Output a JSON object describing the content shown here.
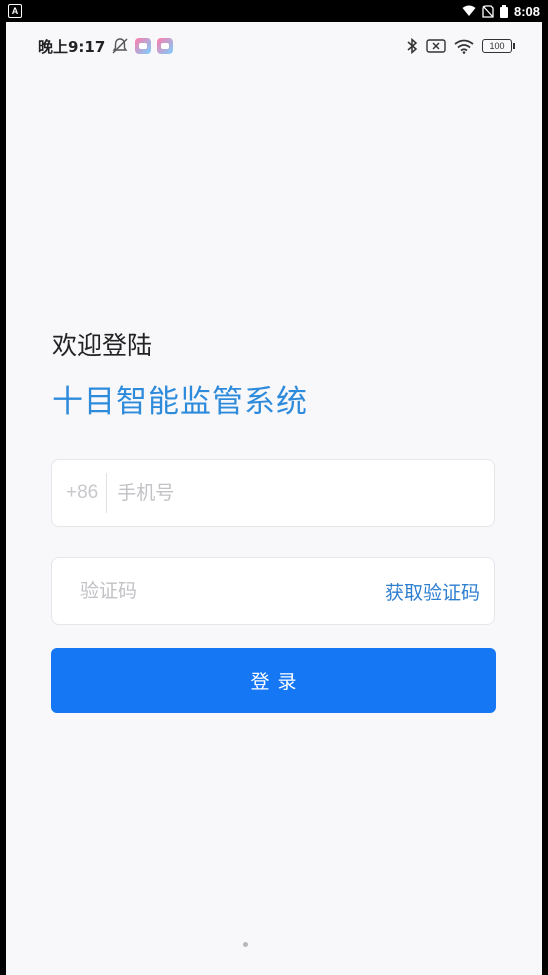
{
  "system_bar": {
    "badge": "A",
    "time": "8:08",
    "icons": [
      "wifi-icon",
      "no-sim-icon",
      "battery-icon"
    ]
  },
  "status_bar": {
    "time": "晚上9:17",
    "battery_level": "100",
    "left_icons": [
      "mute-notification-icon",
      "game-app-icon",
      "game-app-icon"
    ],
    "right_icons": [
      "bluetooth-icon",
      "no-sim-icon",
      "wifi-icon",
      "battery-icon"
    ]
  },
  "login": {
    "welcome": "欢迎登陆",
    "title": "十目智能监管系统",
    "phone": {
      "prefix": "+86",
      "placeholder": "手机号",
      "value": ""
    },
    "code": {
      "placeholder": "验证码",
      "value": "",
      "get_code_label": "获取验证码"
    },
    "submit_label": "登录"
  },
  "colors": {
    "accent": "#1677f5",
    "title": "#2e8bdc",
    "link": "#2e7fd0",
    "background": "#f8f8fa"
  }
}
